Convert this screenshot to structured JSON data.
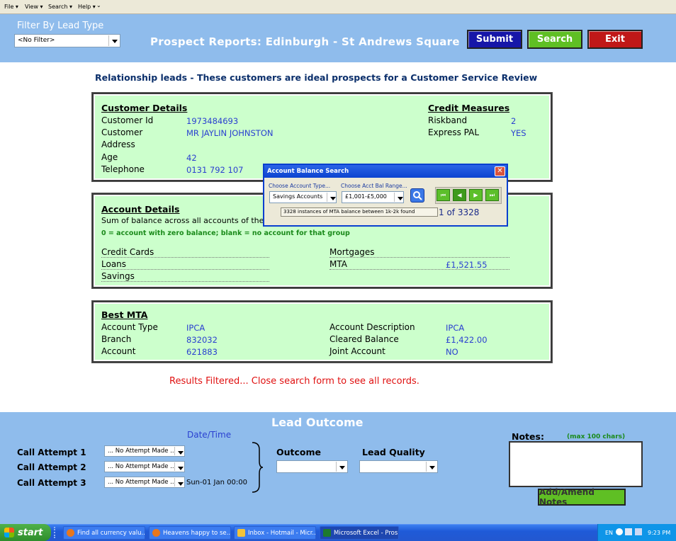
{
  "menu": {
    "file": "File",
    "view": "View",
    "search": "Search",
    "help": "Help"
  },
  "filter": {
    "title": "Filter By Lead Type",
    "value": "<No Filter>"
  },
  "header": {
    "title": "Prospect Reports: Edinburgh - St Andrews Square",
    "submit": "Submit",
    "search": "Search",
    "exit": "Exit"
  },
  "subtitle": "Relationship leads - These customers are ideal prospects for a Customer Service Review",
  "customer": {
    "heading": "Customer Details",
    "id_label": "Customer Id",
    "id": "1973484693",
    "name_label": "Customer",
    "name": "MR JAYLIN JOHNSTON",
    "address_label": "Address",
    "age_label": "Age",
    "age": "42",
    "phone_label": "Telephone",
    "phone": "0131 792 107"
  },
  "credit": {
    "heading": "Credit Measures",
    "riskband_label": "Riskband",
    "riskband": "2",
    "pal_label": "Express PAL",
    "pal": "YES"
  },
  "account": {
    "heading": "Account Details",
    "desc": "Sum of balance across all accounts of the",
    "note": "0 = account with zero balance; blank = no account for that group",
    "credit_cards": "Credit Cards",
    "loans": "Loans",
    "savings": "Savings",
    "mortgages": "Mortgages",
    "mta": "MTA",
    "mta_value": "£1,521.55"
  },
  "best_mta": {
    "heading": "Best MTA",
    "type_label": "Account Type",
    "type": "IPCA",
    "branch_label": "Branch",
    "branch": "832032",
    "account_label": "Account",
    "account": "621883",
    "desc_label": "Account Description",
    "desc": "IPCA",
    "cleared_label": "Cleared Balance",
    "cleared": "£1,422.00",
    "joint_label": "Joint Account",
    "joint": "NO"
  },
  "filtered_msg": "Results Filtered... Close search form to see all records.",
  "dialog": {
    "title": "Account Balance Search",
    "type_label": "Choose Account Type...",
    "type_value": "Savings Accounts",
    "range_label": "Choose Acct Bal Range...",
    "range_value": "£1,001-£5,000",
    "status": "3328 instances of MTA balance between 1k-2k found",
    "record": "1 of 3328",
    "nav": [
      "⏮",
      "◀",
      "▶",
      "⏭"
    ]
  },
  "lead_outcome": {
    "title": "Lead Outcome",
    "datetime_label": "Date/Time",
    "call1": "Call Attempt 1",
    "call2": "Call Attempt 2",
    "call3": "Call Attempt 3",
    "attempt_value": "... No Attempt Made ...",
    "call3_datetime": "Sun-01 Jan 00:00",
    "outcome_label": "Outcome",
    "quality_label": "Lead Quality",
    "notes_label": "Notes:",
    "notes_hint": "(max 100 chars)",
    "notes_button": "Add/Amend Notes"
  },
  "taskbar": {
    "start": "start",
    "tasks": [
      "Find all currency valu...",
      "Heavens happy to se...",
      "Inbox - Hotmail - Micr...",
      "Microsoft Excel - Pros..."
    ],
    "lang": "EN",
    "time": "9:23 PM"
  },
  "colors": {
    "header_bg": "#8fbcec",
    "panel_bg": "#ccffcc",
    "submit": "#1616a8",
    "search": "#5fbf24",
    "exit": "#c01818",
    "value_text": "#2a40d0",
    "filtered_msg": "#e01010"
  }
}
